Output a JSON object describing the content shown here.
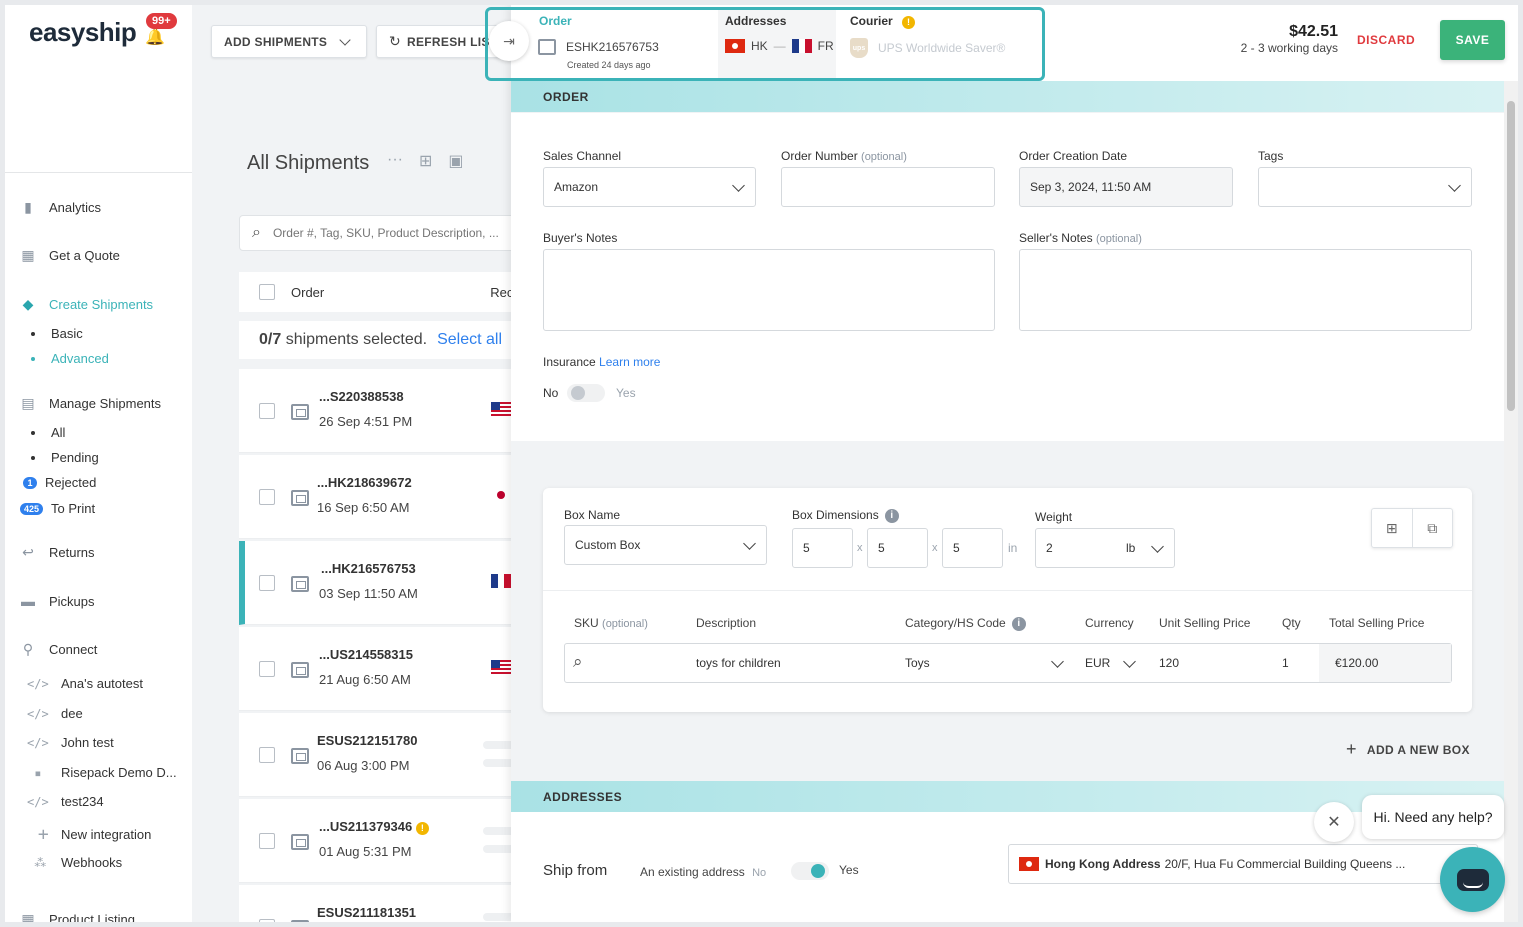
{
  "sidebar": {
    "logo": "easyship",
    "notif_badge": "99+",
    "nav": {
      "analytics": "Analytics",
      "quote": "Get a Quote",
      "create": "Create Shipments",
      "create_basic": "Basic",
      "create_advanced": "Advanced",
      "manage": "Manage Shipments",
      "manage_all": "All",
      "manage_pending": "Pending",
      "manage_rejected": "Rejected",
      "rejected_count": "1",
      "manage_toprint": "To Print",
      "toprint_count": "425",
      "returns": "Returns",
      "pickups": "Pickups",
      "connect": "Connect",
      "product_listing": "Product Listing"
    },
    "connections": [
      "Ana's autotest",
      "dee",
      "John test",
      "Risepack Demo D...",
      "test234",
      "New integration",
      "Webhooks"
    ]
  },
  "toolbar": {
    "add_shipments": "ADD SHIPMENTS",
    "refresh_list": "REFRESH LIST"
  },
  "list": {
    "title": "All Shipments",
    "search_placeholder": "Order #, Tag, SKU, Product Description, ...",
    "col_order": "Order",
    "col_rec": "Rec",
    "selected_count": "0/7",
    "selected_text": "shipments selected.",
    "select_all": "Select all",
    "rows": [
      {
        "id": "...S220388538",
        "date": "26 Sep 4:51 PM"
      },
      {
        "id": "...HK218639672",
        "date": "16 Sep 6:50 AM"
      },
      {
        "id": "...HK216576753",
        "date": "03 Sep 11:50 AM"
      },
      {
        "id": "...US214558315",
        "date": "21 Aug 6:50 AM"
      },
      {
        "id": "ESUS212151780",
        "date": "06 Aug 3:00 PM"
      },
      {
        "id": "...US211379346",
        "date": "01 Aug 5:31 PM"
      },
      {
        "id": "ESUS211181351",
        "date": ""
      }
    ]
  },
  "stepper": {
    "order_label": "Order",
    "order_id": "ESHK216576753",
    "order_created": "Created 24 days ago",
    "addresses_label": "Addresses",
    "from_country": "HK",
    "to_country": "FR",
    "courier_label": "Courier",
    "courier_name": "UPS Worldwide Saver®"
  },
  "summary": {
    "price": "$42.51",
    "eta": "2 - 3 working days",
    "discard": "DISCARD",
    "save": "SAVE"
  },
  "order_section": {
    "header": "ORDER",
    "sales_channel_label": "Sales Channel",
    "sales_channel_value": "Amazon",
    "order_number_label": "Order Number",
    "optional": "(optional)",
    "order_date_label": "Order Creation Date",
    "order_date_value": "Sep 3, 2024, 11:50 AM",
    "tags_label": "Tags",
    "buyer_notes_label": "Buyer's Notes",
    "seller_notes_label": "Seller's Notes",
    "insurance_label": "Insurance",
    "learn_more": "Learn more",
    "no": "No",
    "yes": "Yes"
  },
  "box": {
    "box_name_label": "Box Name",
    "box_name_value": "Custom Box",
    "dimensions_label": "Box Dimensions",
    "dim_l": "5",
    "dim_w": "5",
    "dim_h": "5",
    "x": "x",
    "dim_unit": "in",
    "weight_label": "Weight",
    "weight_value": "2",
    "weight_unit": "lb",
    "col_sku": "SKU",
    "col_description": "Description",
    "col_category": "Category/HS Code",
    "col_currency": "Currency",
    "col_unit_price": "Unit Selling Price",
    "col_qty": "Qty",
    "col_total": "Total Selling Price",
    "item": {
      "description": "toys for children",
      "category": "Toys",
      "currency": "EUR",
      "unit_price": "120",
      "qty": "1",
      "total": "€120.00"
    },
    "add_new_box": "ADD A NEW BOX"
  },
  "addresses_section": {
    "header": "ADDRESSES",
    "ship_from": "Ship from",
    "existing_address": "An existing address",
    "no": "No",
    "yes": "Yes",
    "address_name": "Hong Kong Address",
    "address_detail": "20/F, Hua Fu Commercial Building Queens ..."
  },
  "help": {
    "bubble": "Hi. Need any help?"
  },
  "colors": {
    "accent": "#3bb3b8",
    "save_green": "#3bb37a",
    "discard_red": "#e03a3e"
  }
}
